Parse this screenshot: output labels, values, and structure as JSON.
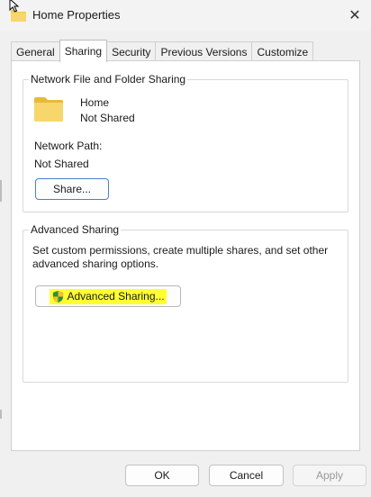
{
  "window": {
    "title": "Home Properties",
    "close_glyph": "✕"
  },
  "tabs": [
    {
      "label": "General"
    },
    {
      "label": "Sharing",
      "active": true
    },
    {
      "label": "Security"
    },
    {
      "label": "Previous Versions"
    },
    {
      "label": "Customize"
    }
  ],
  "network_group": {
    "title": "Network File and Folder Sharing",
    "folder_name": "Home",
    "folder_status": "Not Shared",
    "path_label": "Network Path:",
    "path_value": "Not Shared",
    "share_button": "Share..."
  },
  "advanced_group": {
    "title": "Advanced Sharing",
    "description": "Set custom permissions, create multiple shares, and set other advanced sharing options.",
    "button": "Advanced Sharing...",
    "highlight_color": "#ffff33"
  },
  "footer": {
    "ok": "OK",
    "cancel": "Cancel",
    "apply": "Apply"
  },
  "icons": [
    "folder-icon",
    "shield-icon",
    "close-icon",
    "cursor-icon"
  ]
}
